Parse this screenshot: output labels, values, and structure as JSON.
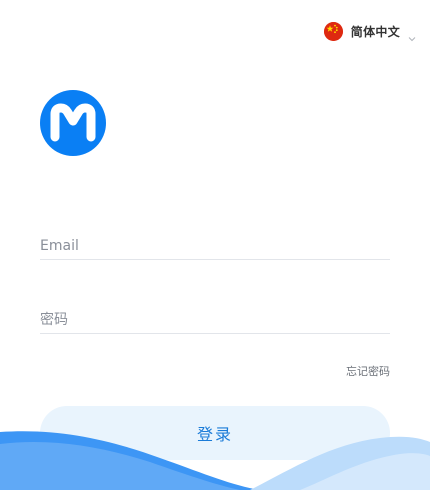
{
  "language": {
    "label": "简体中文",
    "flag_icon": "china-flag-icon",
    "chevron_icon": "chevron-down-icon"
  },
  "logo": {
    "icon": "m-logo-icon",
    "color": "#0a7ff4"
  },
  "form": {
    "email_placeholder": "Email",
    "email_value": "",
    "password_placeholder": "密码",
    "password_value": "",
    "forgot_label": "忘记密码",
    "login_label": "登录"
  },
  "colors": {
    "accent": "#0a7ff4",
    "button_bg": "#e9f4fd",
    "button_text": "#1a7bd8",
    "wave_dark": "#3d96f5",
    "wave_light": "#bcdcfb"
  }
}
